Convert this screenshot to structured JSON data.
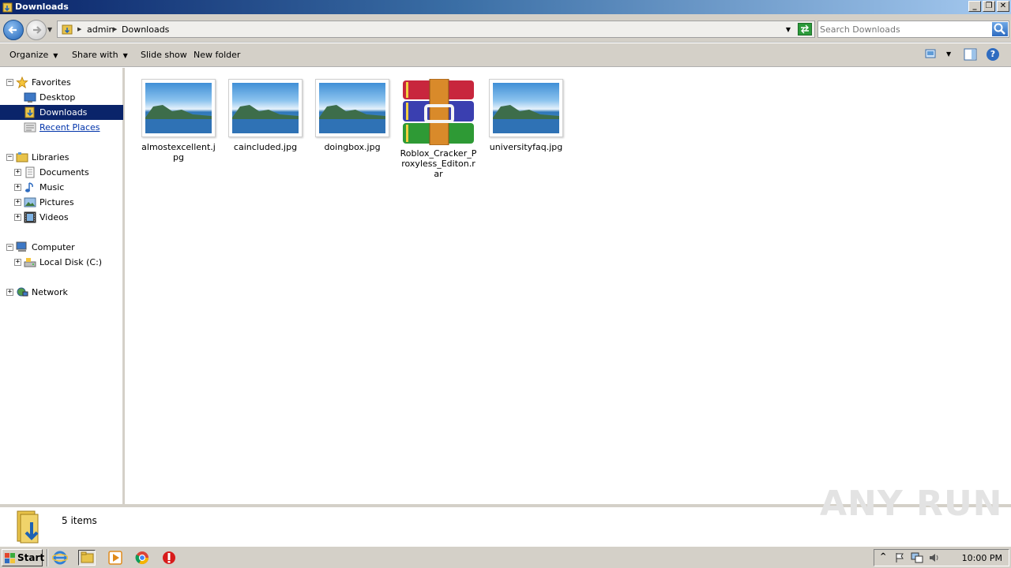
{
  "window": {
    "title": "Downloads",
    "controls": {
      "minimize": "_",
      "restore": "❐",
      "close": "✕"
    }
  },
  "address": {
    "breadcrumbs": [
      "admin",
      "Downloads"
    ],
    "search_placeholder": "Search Downloads"
  },
  "toolbar": {
    "organize": "Organize",
    "share_with": "Share with",
    "slide_show": "Slide show",
    "new_folder": "New folder",
    "help": "?"
  },
  "nav": {
    "favorites": {
      "label": "Favorites",
      "items": [
        "Desktop",
        "Downloads",
        "Recent Places"
      ]
    },
    "libraries": {
      "label": "Libraries",
      "items": [
        "Documents",
        "Music",
        "Pictures",
        "Videos"
      ]
    },
    "computer": {
      "label": "Computer",
      "items": [
        "Local Disk (C:)"
      ]
    },
    "network": {
      "label": "Network"
    },
    "selected": "Downloads",
    "expand_symbol": "+",
    "collapse_symbol": "−"
  },
  "files": [
    {
      "name": "almostexcellent.jpg",
      "type": "image"
    },
    {
      "name": "caincluded.jpg",
      "type": "image"
    },
    {
      "name": "doingbox.jpg",
      "type": "image"
    },
    {
      "name": "Roblox_Cracker_Proxyless_Editon.rar",
      "type": "archive"
    },
    {
      "name": "universityfaq.jpg",
      "type": "image"
    }
  ],
  "details": {
    "item_count": "5 items"
  },
  "watermark": "ANY RUN",
  "taskbar": {
    "start_label": "Start",
    "clock": "10:00 PM",
    "quick_launch": [
      "internet-explorer-icon",
      "windows-explorer-icon",
      "media-player-icon",
      "chrome-icon",
      "antivirus-icon"
    ]
  },
  "colors": {
    "selection": "#0a246a",
    "titlebar": "#0a246a",
    "chrome": "#d4d0c8"
  }
}
